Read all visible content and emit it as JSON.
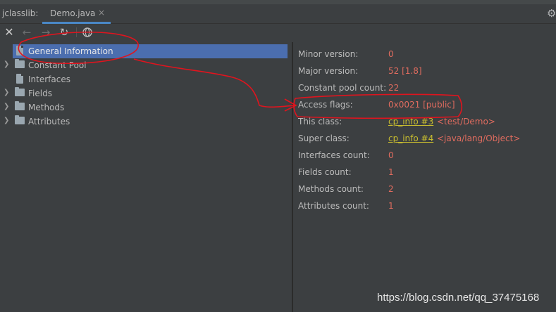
{
  "tabbar": {
    "tool_label": "jclasslib:",
    "tab_label": "Demo.java",
    "tab_close": "×",
    "settings_icon": "⚙"
  },
  "toolbar": {
    "close_icon": "✕",
    "back_icon": "←",
    "forward_icon": "→",
    "refresh_icon": "↻",
    "web_icon": "🌐"
  },
  "tree": {
    "items": [
      {
        "label": "General Information",
        "icon": "file-icon",
        "selected": true
      },
      {
        "label": "Constant Pool",
        "icon": "folder-icon",
        "expandable": true
      },
      {
        "label": "Interfaces",
        "icon": "file-icon"
      },
      {
        "label": "Fields",
        "icon": "folder-icon",
        "expandable": true
      },
      {
        "label": "Methods",
        "icon": "folder-icon",
        "expandable": true
      },
      {
        "label": "Attributes",
        "icon": "folder-icon",
        "expandable": true
      }
    ]
  },
  "info": {
    "rows": [
      {
        "key": "Minor version:",
        "value": "0"
      },
      {
        "key": "Major version:",
        "value": "52 [1.8]"
      },
      {
        "key": "Constant pool count:",
        "value": "22"
      },
      {
        "key": "Access flags:",
        "value": "0x0021 [public]"
      },
      {
        "key": "This class:",
        "link": "cp_info #3",
        "note": "<test/Demo>"
      },
      {
        "key": "Super class:",
        "link": "cp_info #4",
        "note": "<java/lang/Object>"
      },
      {
        "key": "Interfaces count:",
        "value": "0"
      },
      {
        "key": "Fields count:",
        "value": "1"
      },
      {
        "key": "Methods count:",
        "value": "2"
      },
      {
        "key": "Attributes count:",
        "value": "1"
      }
    ]
  },
  "colors": {
    "background": "#3c3f41",
    "selection": "#4b6eaf",
    "value_red": "#e06c5f",
    "link_yellow": "#c8bd2f",
    "annotation_red": "#e0141e"
  },
  "watermark": "https://blog.csdn.net/qq_37475168"
}
